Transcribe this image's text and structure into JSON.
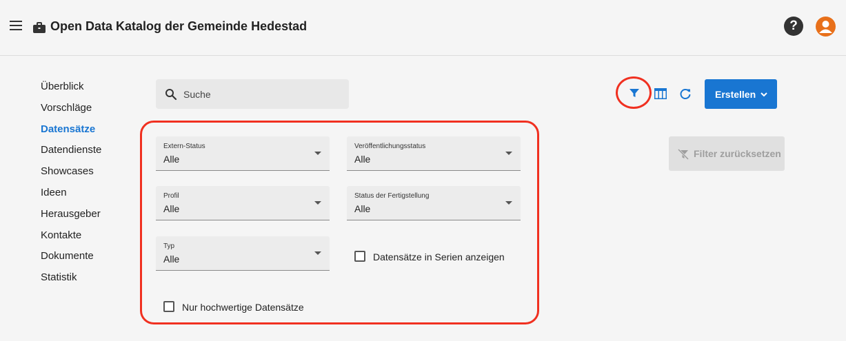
{
  "app": {
    "title": "Open Data Katalog der Gemeinde Hedestad"
  },
  "icons": {
    "menu": "menu-icon",
    "briefcase": "briefcase-icon",
    "help": "help-icon",
    "avatar": "user-avatar-icon"
  },
  "nav": {
    "items": [
      {
        "label": "Überblick"
      },
      {
        "label": "Vorschläge"
      },
      {
        "label": "Datensätze"
      },
      {
        "label": "Datendienste"
      },
      {
        "label": "Showcases"
      },
      {
        "label": "Ideen"
      },
      {
        "label": "Herausgeber"
      },
      {
        "label": "Kontakte"
      },
      {
        "label": "Dokumente"
      },
      {
        "label": "Statistik"
      }
    ],
    "active_index": 2
  },
  "search": {
    "placeholder": "Suche"
  },
  "toolbar": {
    "create_label": "Erstellen",
    "reset_filter_label": "Filter zurücksetzen"
  },
  "filters": {
    "extern_status": {
      "label": "Extern-Status",
      "value": "Alle"
    },
    "publication_status": {
      "label": "Veröffentlichungsstatus",
      "value": "Alle"
    },
    "profile": {
      "label": "Profil",
      "value": "Alle"
    },
    "completion_status": {
      "label": "Status der Fertigstellung",
      "value": "Alle"
    },
    "type": {
      "label": "Typ",
      "value": "Alle"
    },
    "show_in_series": {
      "label": "Datensätze in Serien anzeigen",
      "checked": false
    },
    "high_value_only": {
      "label": "Nur hochwertige Datensätze",
      "checked": false
    }
  },
  "colors": {
    "accent": "#1976d2",
    "highlight": "#f03020",
    "avatar": "#e8701a"
  }
}
